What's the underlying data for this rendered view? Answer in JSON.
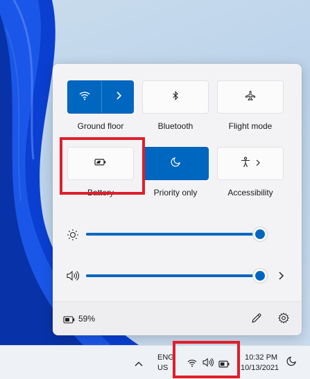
{
  "quick_settings": {
    "tiles": [
      {
        "id": "wifi",
        "label": "Ground floor",
        "active": true
      },
      {
        "id": "bluetooth",
        "label": "Bluetooth",
        "active": false
      },
      {
        "id": "flight",
        "label": "Flight mode",
        "active": false
      },
      {
        "id": "battery",
        "label": "Battery",
        "active": false
      },
      {
        "id": "focus",
        "label": "Priority only",
        "active": true
      },
      {
        "id": "accessibility",
        "label": "Accessibility",
        "active": false
      }
    ],
    "brightness_level": 1.0,
    "volume_level": 1.0,
    "battery_percent": "59%"
  },
  "taskbar": {
    "lang_line1": "ENG",
    "lang_line2": "US",
    "time": "10:32 PM",
    "date": "10/13/2021"
  },
  "colors": {
    "accent": "#0067c0",
    "highlight": "#e11d2a"
  }
}
